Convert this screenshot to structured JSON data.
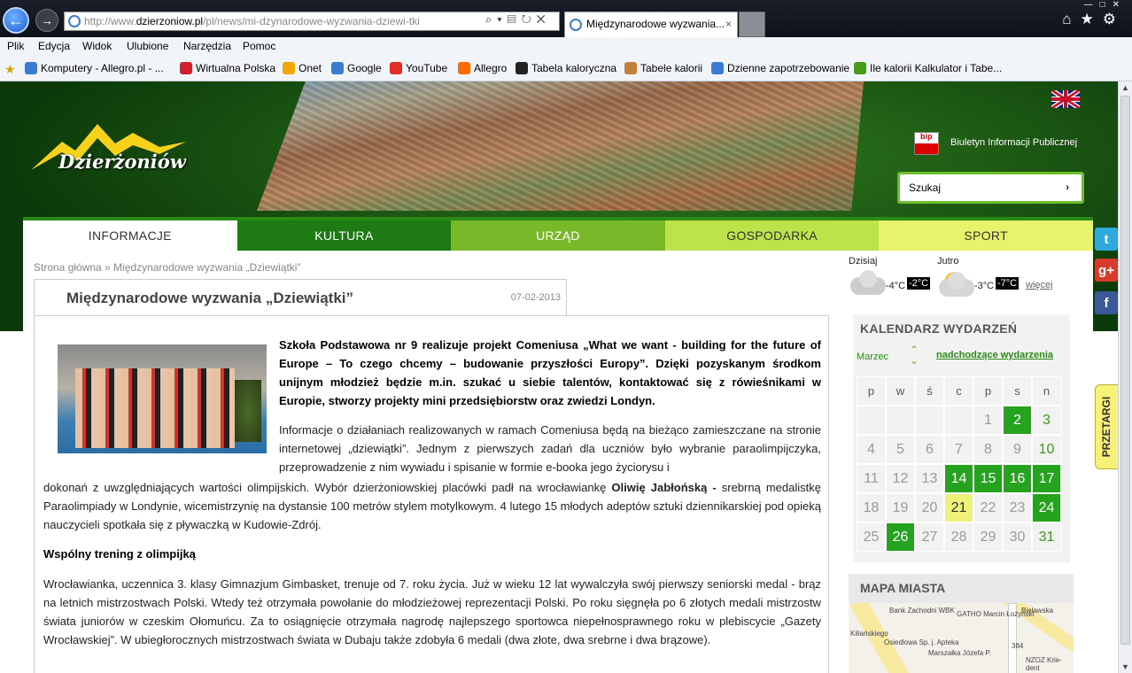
{
  "browser": {
    "url_prefix": "http://www.",
    "url_domain": "dzierzoniow.pl",
    "url_path": "/pl/news/mi-dzynarodowe-wyzwania-dziewi-tki",
    "tab_title": "Międzynarodowe wyzwania...",
    "menu": [
      "Plik",
      "Edycja",
      "Widok",
      "Ulubione",
      "Narzędzia",
      "Pomoc"
    ],
    "favorites": [
      {
        "label": "Komputery - Allegro.pl - ...",
        "color": "#3b7bd4"
      },
      {
        "label": "Wirtualna Polska",
        "color": "#d21f2b"
      },
      {
        "label": "Onet",
        "color": "#f0a800"
      },
      {
        "label": "Google",
        "color": "#3b7bd4"
      },
      {
        "label": "YouTube",
        "color": "#e52d27"
      },
      {
        "label": "Allegro",
        "color": "#ff6a00"
      },
      {
        "label": "Tabela kaloryczna",
        "color": "#222222"
      },
      {
        "label": "Tabele kalorii",
        "color": "#c0803a"
      },
      {
        "label": "Dzienne zapotrzebowanie",
        "color": "#3b7bd4"
      },
      {
        "label": "Ile kalorii Kalkulator i Tabe...",
        "color": "#4a9a1c"
      }
    ]
  },
  "site": {
    "logo_text": "Dzierżoniów",
    "bip_label": "bip",
    "bip_text": "Biuletyn Informacji Publicznej",
    "search_label": "Szukaj",
    "search_go": "›",
    "nav": [
      {
        "label": "INFORMACJE",
        "bg": "#ffffff",
        "fg": "#333333"
      },
      {
        "label": "KULTURA",
        "bg": "#1e7a14",
        "fg": "#ffffff"
      },
      {
        "label": "URZĄD",
        "bg": "#79b828",
        "fg": "#ffffff"
      },
      {
        "label": "GOSPODARKA",
        "bg": "#bde34a",
        "fg": "#333333"
      },
      {
        "label": "SPORT",
        "bg": "#e8f26a",
        "fg": "#333333"
      }
    ]
  },
  "article": {
    "breadcrumb": "Strona główna » Międzynarodowe wyzwania „Dziewiątki”",
    "title": "Międzynarodowe wyzwania „Dziewiątki”",
    "date": "07-02-2013",
    "lead": "Szkoła Podstawowa nr 9 realizuje projekt Comeniusa „What we want - building for the future of Europe – To czego chcemy – budowanie przyszłości Europy”. Dzięki pozyskanym środkom unijnym młodzież będzie m.in. szukać u siebie talentów, kontaktować się z rówieśnikami w Europie, stworzy projekty mini przedsiębiorstw oraz zwiedzi Londyn.",
    "p1": "Informacje o działaniach realizowanych w ramach Comeniusa będą na bieżąco zamieszczane na stronie internetowej „dziewiątki”. Jednym z pierwszych zadań dla uczniów było wybranie paraolimpijczyka, przeprowadzenie z nim wywiadu i spisanie w formie e-booka jego życiorysu i",
    "p2_a": "dokonań z uwzględniających wartości olimpijskich. Wybór dzierżoniowskiej placówki padł na wrocławiankę ",
    "p2_bold": "Oliwię Jabłońską -",
    "p2_b": " srebrną medalistkę Paraolimpiady w Londynie, wicemistrzynię na dystansie 100 metrów stylem motylkowym. 4 lutego 15 młodych adeptów sztuki dziennikarskiej pod opieką nauczycieli spotkała się z pływaczką w Kudowie-Zdrój.",
    "subtitle": "Wspólny trening z olimpijką",
    "p3": "Wrocławianka, uczennica 3. klasy Gimnazjum Gimbasket, trenuje od 7. roku życia. Już w wieku 12 lat wywalczyła swój pierwszy seniorski medal - brąz na letnich mistrzostwach Polski. Wtedy też otrzymała powołanie do młodzieżowej reprezentacji Polski. Po roku sięgnęła po 6 złotych medali mistrzostw świata juniorów w czeskim Ołomuńcu. Za to osiągnięcie otrzymała nagrodę najlepszego sportowca niepełnosprawnego roku w plebiscycie „Gazety Wrocławskiej”. W ubiegłorocznych mistrzostwach świata w Dubaju także zdobyła 6 medali (dwa złote, dwa srebrne i dwa brązowe)."
  },
  "weather": {
    "today_label": "Dzisiaj",
    "today_min": "-4°C",
    "today_max": "-2°C",
    "tomorrow_label": "Jutro",
    "tomorrow_min": "-3°C",
    "tomorrow_max": "-7°C",
    "more": "więcej"
  },
  "calendar": {
    "title": "KALENDARZ WYDARZEŃ",
    "month": "Marzec",
    "upcoming": "nadchodzące wydarzenia",
    "weekdays": [
      "p",
      "w",
      "ś",
      "c",
      "p",
      "s",
      "n"
    ],
    "days": [
      {
        "d": "",
        "s": ""
      },
      {
        "d": "",
        "s": ""
      },
      {
        "d": "",
        "s": ""
      },
      {
        "d": "",
        "s": ""
      },
      {
        "d": "1",
        "s": ""
      },
      {
        "d": "2",
        "s": "g"
      },
      {
        "d": "3",
        "s": "lg"
      },
      {
        "d": "4",
        "s": ""
      },
      {
        "d": "5",
        "s": ""
      },
      {
        "d": "6",
        "s": ""
      },
      {
        "d": "7",
        "s": ""
      },
      {
        "d": "8",
        "s": ""
      },
      {
        "d": "9",
        "s": ""
      },
      {
        "d": "10",
        "s": "lg"
      },
      {
        "d": "11",
        "s": ""
      },
      {
        "d": "12",
        "s": ""
      },
      {
        "d": "13",
        "s": ""
      },
      {
        "d": "14",
        "s": "g"
      },
      {
        "d": "15",
        "s": "g"
      },
      {
        "d": "16",
        "s": "g"
      },
      {
        "d": "17",
        "s": "g"
      },
      {
        "d": "18",
        "s": ""
      },
      {
        "d": "19",
        "s": ""
      },
      {
        "d": "20",
        "s": ""
      },
      {
        "d": "21",
        "s": "y"
      },
      {
        "d": "22",
        "s": ""
      },
      {
        "d": "23",
        "s": ""
      },
      {
        "d": "24",
        "s": "g"
      },
      {
        "d": "25",
        "s": ""
      },
      {
        "d": "26",
        "s": "g"
      },
      {
        "d": "27",
        "s": ""
      },
      {
        "d": "28",
        "s": ""
      },
      {
        "d": "29",
        "s": ""
      },
      {
        "d": "30",
        "s": ""
      },
      {
        "d": "31",
        "s": "lg"
      }
    ]
  },
  "map": {
    "title": "MAPA MIASTA",
    "labels": [
      "Bank Zachodni WBK",
      "GATHO Marcin Łożyński",
      "Osiedlowa Sp. j. Apteka",
      "Bielawska",
      "NZOZ Krie-dent",
      "384",
      "Kiliańskiego",
      "Marszałka Józefa P."
    ]
  },
  "side": {
    "pretargi": "PRZETARGI",
    "social": [
      {
        "name": "twitter",
        "glyph": "t",
        "color": "#2fa8e0"
      },
      {
        "name": "google-plus",
        "glyph": "g+",
        "color": "#d63b2b"
      },
      {
        "name": "facebook",
        "glyph": "f",
        "color": "#3b5998"
      }
    ]
  }
}
